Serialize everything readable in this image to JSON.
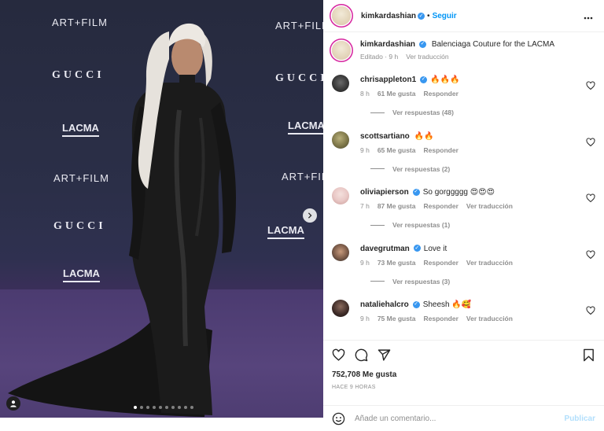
{
  "post": {
    "media": {
      "backdrop_logos": {
        "art_film": "ART+FILM",
        "gucci": "GUCCI",
        "lacma": "LACMA"
      },
      "carousel_dots_total": 10,
      "carousel_active_index": 0,
      "next_icon": "chevron-right-icon",
      "tag_icon": "user-tag-icon"
    },
    "header": {
      "username": "kimkardashian",
      "verified": true,
      "follow_label": "Seguir",
      "more_icon": "ellipsis-icon"
    },
    "caption": {
      "username": "kimkardashian",
      "text": "Balenciaga Couture for the LACMA",
      "edited_label": "Editado",
      "time": "9 h",
      "translation_label": "Ver traducción"
    },
    "comments": [
      {
        "username": "chrisappleton1",
        "verified": true,
        "text": "🔥🔥🔥",
        "time": "8 h",
        "likes": "61 Me gusta",
        "reply_label": "Responder",
        "translation_label": "",
        "replies_label": "Ver respuestas (48)"
      },
      {
        "username": "scottsartiano",
        "verified": false,
        "text": "🔥🔥",
        "time": "9 h",
        "likes": "65 Me gusta",
        "reply_label": "Responder",
        "translation_label": "",
        "replies_label": "Ver respuestas (2)"
      },
      {
        "username": "oliviapierson",
        "verified": true,
        "text": "So gorggggg 😍😍😍",
        "time": "7 h",
        "likes": "87 Me gusta",
        "reply_label": "Responder",
        "translation_label": "Ver traducción",
        "replies_label": "Ver respuestas (1)"
      },
      {
        "username": "davegrutman",
        "verified": true,
        "text": "Love it",
        "time": "9 h",
        "likes": "73 Me gusta",
        "reply_label": "Responder",
        "translation_label": "Ver traducción",
        "replies_label": "Ver respuestas (3)"
      },
      {
        "username": "nataliehalcro",
        "verified": true,
        "text": "Sheesh 🔥🥰",
        "time": "9 h",
        "likes": "75 Me gusta",
        "reply_label": "Responder",
        "translation_label": "Ver traducción",
        "replies_label": ""
      }
    ],
    "actions": {
      "like_icon": "heart-icon",
      "comment_icon": "comment-icon",
      "share_icon": "send-icon",
      "save_icon": "bookmark-icon",
      "likes_count": "752,708 Me gusta",
      "time_ago": "HACE 9 HORAS"
    },
    "comment_box": {
      "emoji_icon": "emoji-icon",
      "placeholder": "Añade un comentario...",
      "post_label": "Publicar"
    },
    "colors": {
      "accent": "#0095f6",
      "verified": "#3897f0",
      "muted": "#8e8e8e",
      "post_disabled": "#b2dffc"
    }
  }
}
